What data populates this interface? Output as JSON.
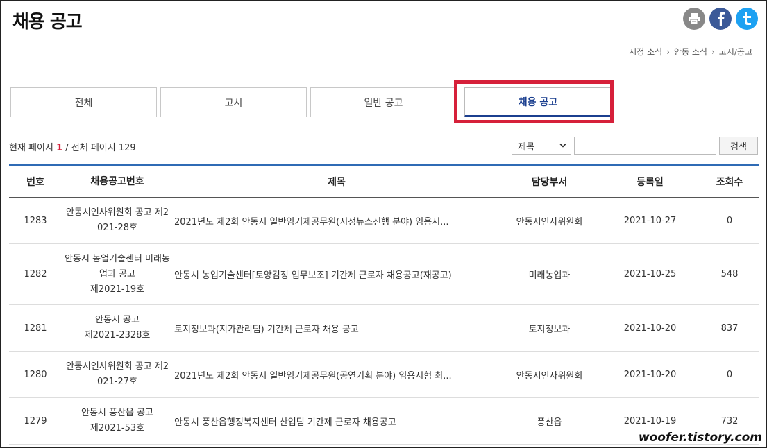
{
  "page": {
    "title": "채용 공고"
  },
  "share_icons": [
    "print-icon",
    "facebook-icon",
    "twitter-icon"
  ],
  "breadcrumb": [
    "시정 소식",
    "안동 소식",
    "고시/공고"
  ],
  "tabs": [
    {
      "label": "전체",
      "active": false
    },
    {
      "label": "고시",
      "active": false
    },
    {
      "label": "일반 공고",
      "active": false
    },
    {
      "label": "채용 공고",
      "active": true
    }
  ],
  "pageinfo": {
    "prefix": "현재 페이지",
    "current": "1",
    "middle": "/ 전체 페이지",
    "total": "129"
  },
  "search": {
    "select_value": "제목",
    "input_value": "",
    "button_label": "검색"
  },
  "table": {
    "headers": [
      "번호",
      "채용공고번호",
      "제목",
      "담당부서",
      "등록일",
      "조회수"
    ],
    "rows": [
      {
        "no": "1283",
        "notice_no_lines": [
          "안동시인사위원회 공고 제2",
          "021-28호"
        ],
        "title": "2021년도 제2회 안동시 일반임기제공무원(시정뉴스진행 분야) 임용시...",
        "dept": "안동시인사위원회",
        "date": "2021-10-27",
        "views": "0"
      },
      {
        "no": "1282",
        "notice_no_lines": [
          "안동시 농업기술센터 미래농",
          "업과 공고",
          "제2021-19호"
        ],
        "title": "안동시 농업기술센터[토양검정 업무보조] 기간제 근로자 채용공고(재공고)",
        "dept": "미래농업과",
        "date": "2021-10-25",
        "views": "548"
      },
      {
        "no": "1281",
        "notice_no_lines": [
          "안동시 공고",
          "제2021-2328호"
        ],
        "title": "토지정보과(지가관리팀) 기간제 근로자 채용 공고",
        "dept": "토지정보과",
        "date": "2021-10-20",
        "views": "837"
      },
      {
        "no": "1280",
        "notice_no_lines": [
          "안동시인사위원회 공고 제2",
          "021-27호"
        ],
        "title": "2021년도 제2회 안동시 일반임기제공무원(공연기획 분야) 임용시험 최...",
        "dept": "안동시인사위원회",
        "date": "2021-10-20",
        "views": "0"
      },
      {
        "no": "1279",
        "notice_no_lines": [
          "안동시 풍산읍 공고",
          "제2021-53호"
        ],
        "title": "안동시 풍산읍행정복지센터 산업팀 기간제 근로자 채용공고",
        "dept": "풍산읍",
        "date": "2021-10-19",
        "views": "732"
      }
    ]
  },
  "watermark": "woofer.tistory.com",
  "colors": {
    "accent": "#1b3f8f",
    "highlight": "#d6203a",
    "table_rule": "#2f6bb5"
  }
}
